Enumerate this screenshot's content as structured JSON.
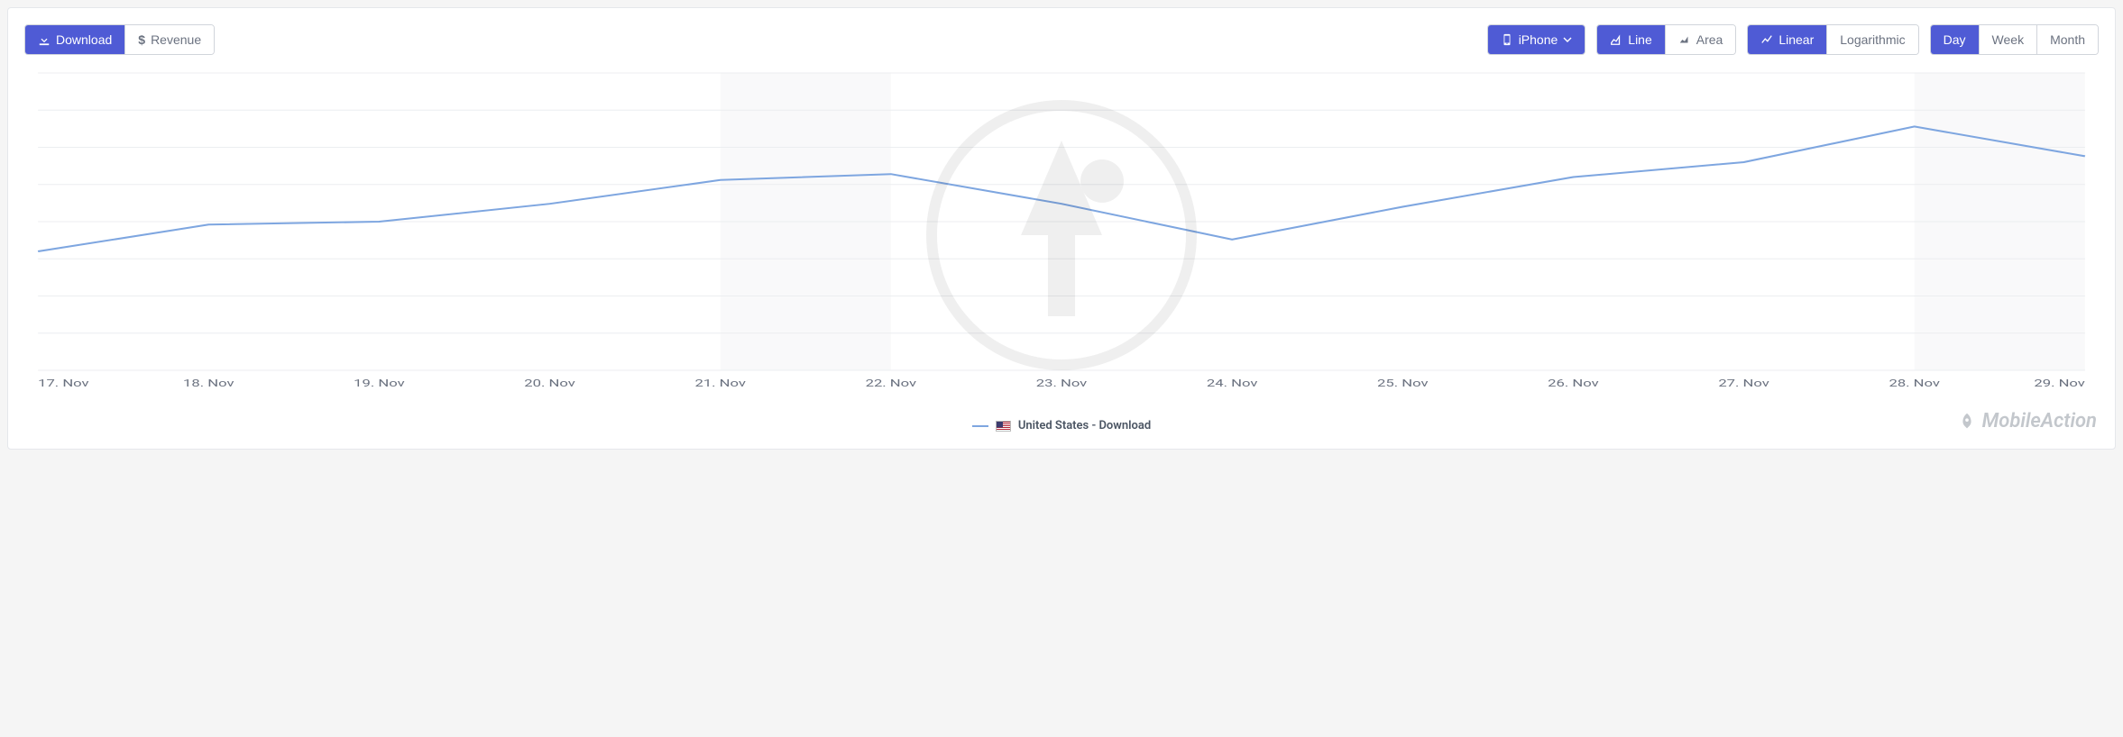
{
  "toolbar": {
    "download": "Download",
    "revenue": "Revenue",
    "device": "iPhone",
    "line": "Line",
    "area": "Area",
    "linear": "Linear",
    "log": "Logarithmic",
    "day": "Day",
    "week": "Week",
    "month": "Month"
  },
  "legend": {
    "series": "United States - Download"
  },
  "brand": "MobileAction",
  "chart_data": {
    "type": "line",
    "title": "",
    "xlabel": "",
    "ylabel": "",
    "categories": [
      "17. Nov",
      "18. Nov",
      "19. Nov",
      "20. Nov",
      "21. Nov",
      "22. Nov",
      "23. Nov",
      "24. Nov",
      "25. Nov",
      "26. Nov",
      "27. Nov",
      "28. Nov",
      "29. Nov"
    ],
    "weekend_indices": [
      [
        4,
        5
      ],
      [
        11,
        12
      ]
    ],
    "series": [
      {
        "name": "United States - Download",
        "color": "#7ea6e0",
        "values": [
          40,
          49,
          50,
          56,
          64,
          66,
          56,
          44,
          55,
          65,
          70,
          82,
          72
        ]
      }
    ],
    "ylim": [
      0,
      100
    ],
    "grid": true,
    "legend_position": "bottom"
  }
}
